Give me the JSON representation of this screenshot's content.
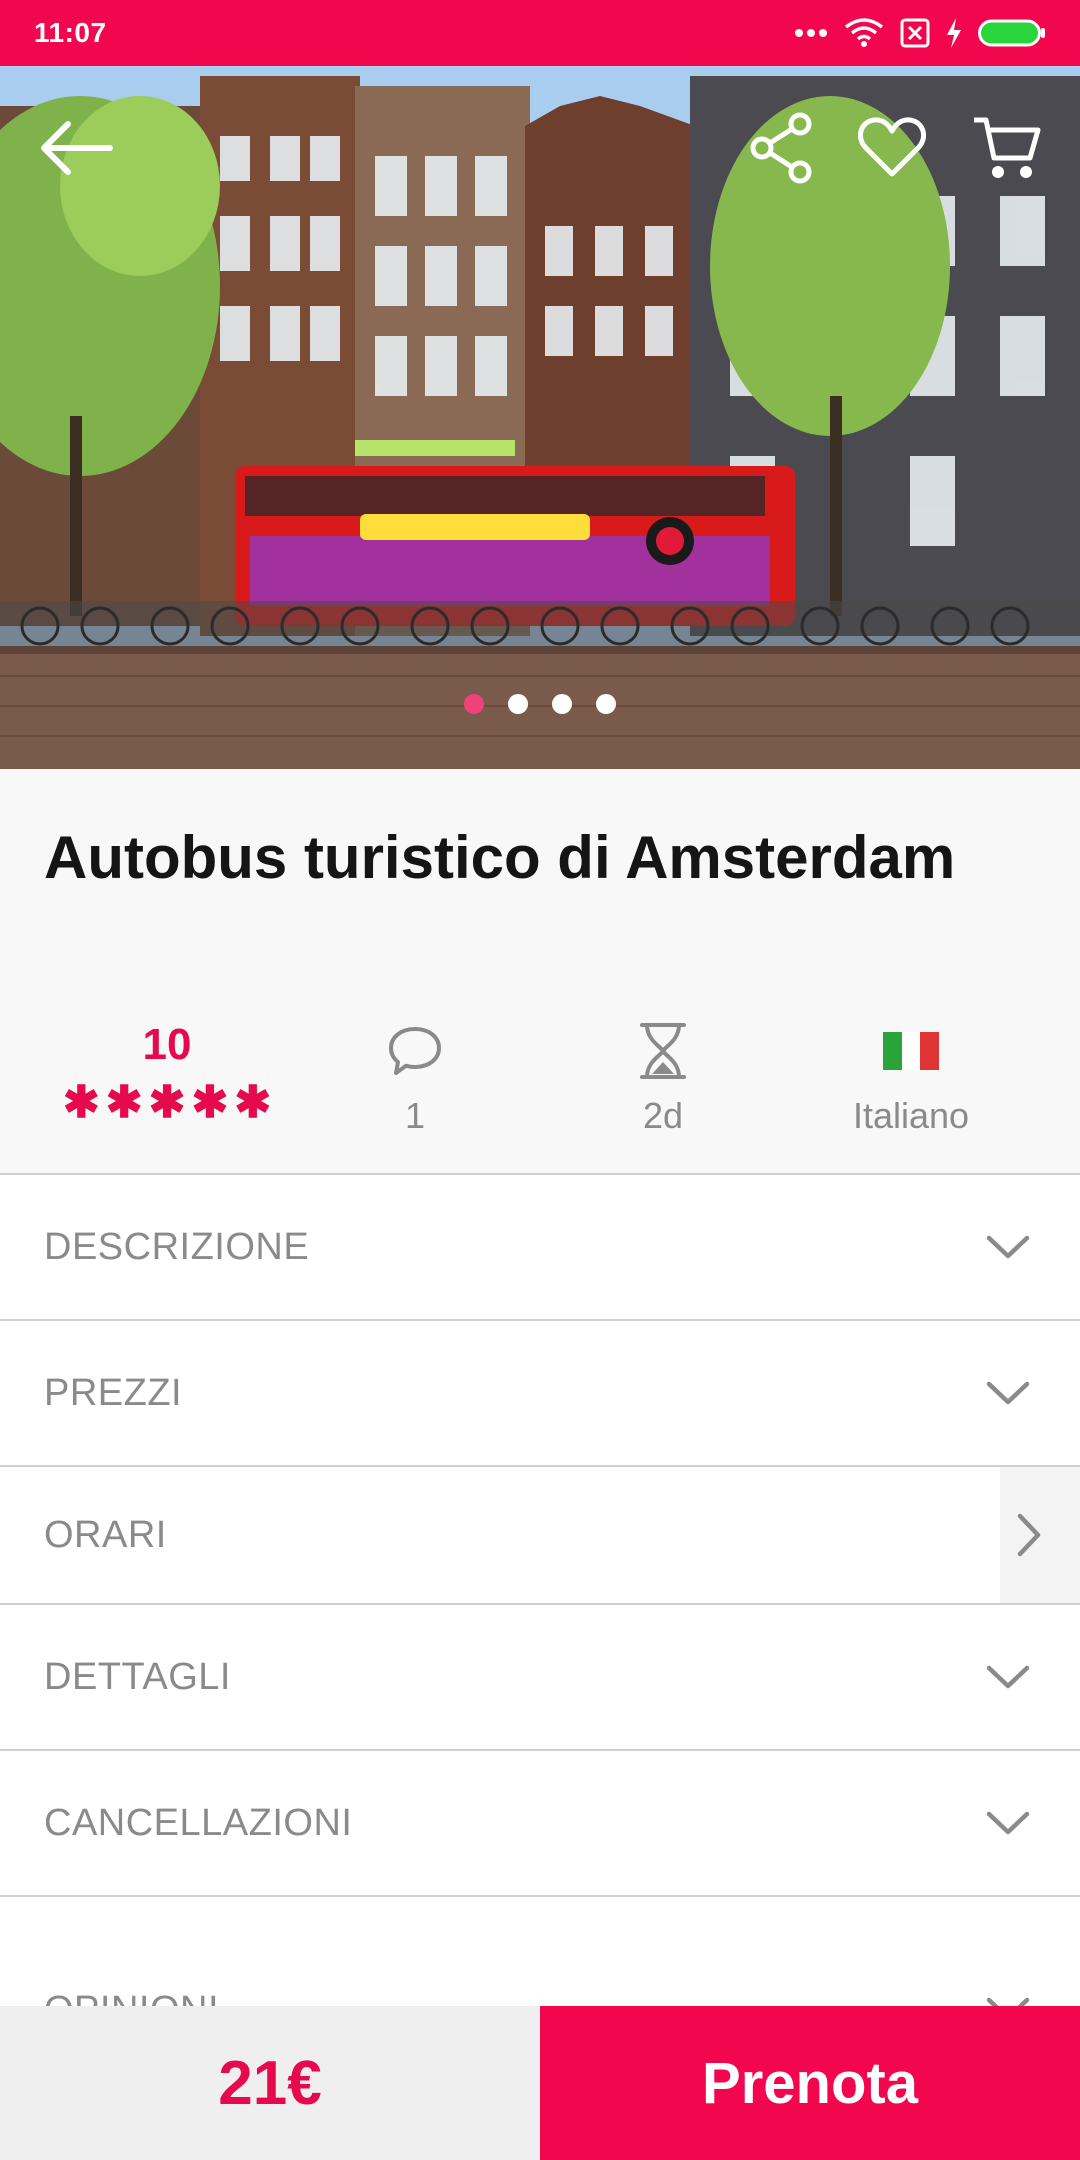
{
  "status_bar": {
    "time": "11:07",
    "icons": [
      "more-dots-icon",
      "wifi-icon",
      "sim-none-icon",
      "charging-icon",
      "battery-icon"
    ],
    "color": "#f2074f"
  },
  "hero": {
    "icons": [
      "back-arrow-icon",
      "share-icon",
      "heart-icon",
      "cart-icon"
    ],
    "carousel": {
      "count": 4,
      "active_index": 0
    }
  },
  "product": {
    "title": "Autobus turistico di Amsterdam",
    "rating_score": "10",
    "stars": 5,
    "comments_count": "1",
    "duration": "2d",
    "language": "Italiano",
    "language_flag": "italy-flag-icon"
  },
  "sections": [
    {
      "label": "DESCRIZIONE",
      "icon": "chevron-down-icon"
    },
    {
      "label": "PREZZI",
      "icon": "chevron-down-icon"
    },
    {
      "label": "ORARI",
      "icon": "chevron-right-icon"
    },
    {
      "label": "DETTAGLI",
      "icon": "chevron-down-icon"
    },
    {
      "label": "CANCELLAZIONI",
      "icon": "chevron-down-icon"
    },
    {
      "label": "OPINIONI",
      "icon": "chevron-down-icon"
    }
  ],
  "bottom_bar": {
    "price": "21€",
    "book_label": "Prenota"
  },
  "colors": {
    "accent": "#f2074f",
    "rating": "#e6094e",
    "muted_text": "#8a8a8a"
  }
}
